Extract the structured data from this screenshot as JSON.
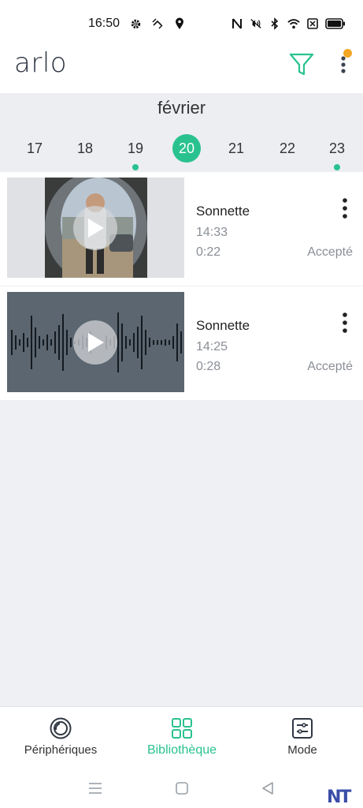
{
  "status_bar": {
    "time": "16:50",
    "left_icons": [
      "gear-icon",
      "nfc-rotate-icon",
      "location-icon"
    ],
    "right_icons": [
      "nfc-icon",
      "mute-icon",
      "bluetooth-icon",
      "wifi-icon",
      "sim-icon",
      "battery-icon"
    ]
  },
  "header": {
    "logo": "arlo",
    "filter_icon": "filter-icon",
    "menu_icon": "more-vertical-icon",
    "notification_dot_color": "#f5a623"
  },
  "date_strip": {
    "month": "février",
    "days": [
      {
        "label": "17",
        "selected": false,
        "has_recordings": false
      },
      {
        "label": "18",
        "selected": false,
        "has_recordings": false
      },
      {
        "label": "19",
        "selected": false,
        "has_recordings": true
      },
      {
        "label": "20",
        "selected": true,
        "has_recordings": false
      },
      {
        "label": "21",
        "selected": false,
        "has_recordings": false
      },
      {
        "label": "22",
        "selected": false,
        "has_recordings": false
      },
      {
        "label": "23",
        "selected": false,
        "has_recordings": true
      }
    ],
    "accent_color": "#29c28f"
  },
  "recordings": [
    {
      "title": "Sonnette",
      "time": "14:33",
      "duration": "0:22",
      "status": "Accepté",
      "thumbnail": "video-thumbnail"
    },
    {
      "title": "Sonnette",
      "time": "14:25",
      "duration": "0:28",
      "status": "Accepté",
      "thumbnail": "audio-waveform-thumbnail"
    }
  ],
  "bottom_nav": {
    "items": [
      {
        "label": "Périphériques",
        "icon": "devices-icon",
        "active": false
      },
      {
        "label": "Bibliothèque",
        "icon": "library-grid-icon",
        "active": true
      },
      {
        "label": "Mode",
        "icon": "mode-sliders-icon",
        "active": false
      }
    ]
  },
  "system_nav": {
    "icons": [
      "recent-apps-icon",
      "home-icon",
      "back-icon"
    ]
  },
  "watermark": "NT"
}
